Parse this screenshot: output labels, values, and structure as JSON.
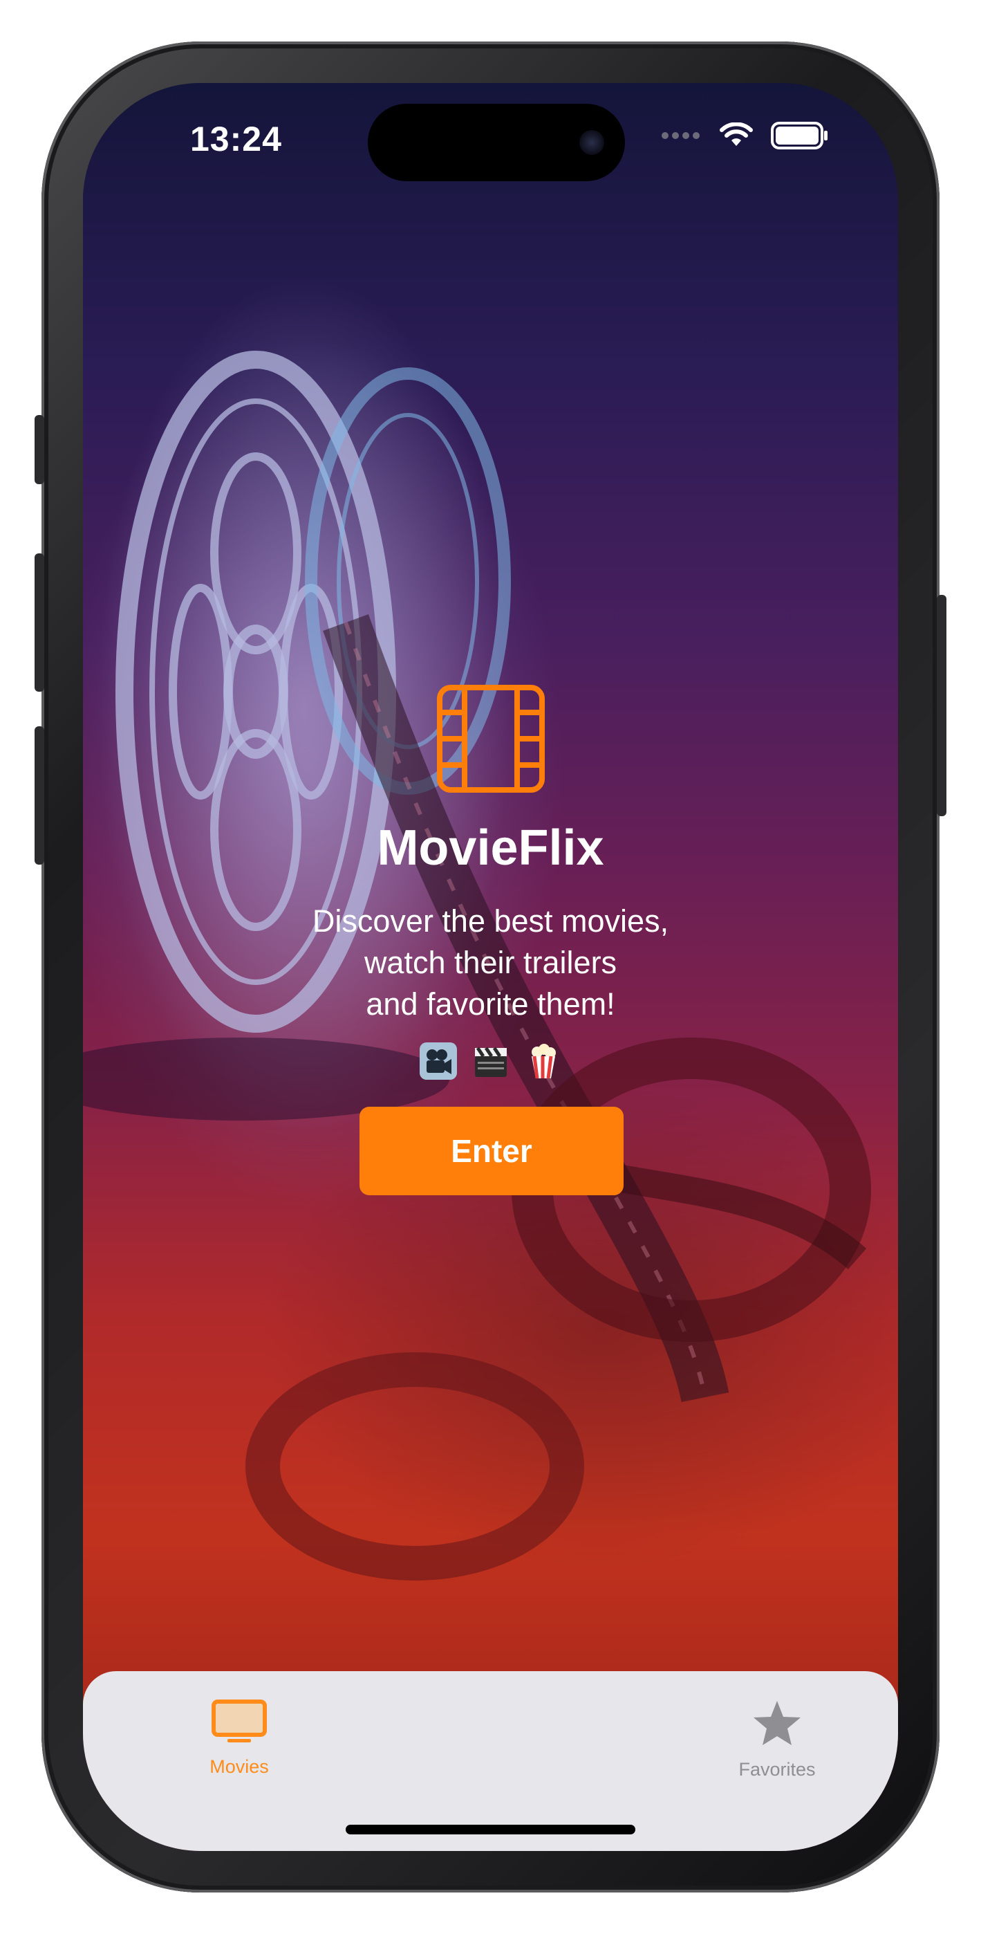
{
  "status_bar": {
    "time": "13:24"
  },
  "hero": {
    "app_name": "MovieFlix",
    "description": "Discover the best movies,\nwatch their trailers\nand favorite them!",
    "emojis": [
      "movie-camera",
      "clapper-board",
      "popcorn"
    ],
    "enter_label": "Enter"
  },
  "tab_bar": {
    "tabs": [
      {
        "label": "Movies",
        "icon": "tv-icon",
        "active": true
      },
      {
        "label": "Favorites",
        "icon": "star-icon",
        "active": false
      }
    ]
  },
  "colors": {
    "accent": "#ff7f0a",
    "tab_inactive": "#8e8e93",
    "tab_bar_bg": "#e6e6eb"
  }
}
